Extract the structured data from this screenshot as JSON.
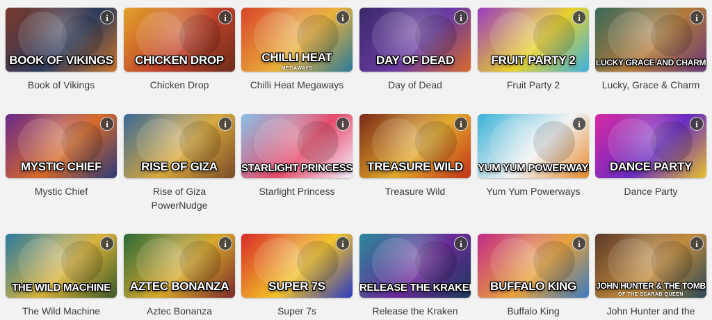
{
  "games": [
    {
      "title": "Book of Vikings",
      "art_title": "BOOK OF VIKINGS",
      "bg": "#7a3a2a,#2e3b5c,#c8742c"
    },
    {
      "title": "Chicken Drop",
      "art_title": "CHICKEN DROP",
      "bg": "#e2a32a,#c2412a,#6b2d1b"
    },
    {
      "title": "Chilli Heat Megaways",
      "art_title": "CHILLI HEAT",
      "art_sub": "MEGAWAYS",
      "bg": "#d8452a,#e9b13a,#2a7a9a"
    },
    {
      "title": "Day of Dead",
      "art_title": "DAY OF DEAD",
      "bg": "#3a2a6a,#6a3aa2,#d86a2a"
    },
    {
      "title": "Fruit Party 2",
      "art_title": "FRUIT PARTY 2",
      "bg": "#9a3ac2,#e8d12a,#3ab2e2"
    },
    {
      "title": "Lucky, Grace & Charm",
      "art_title": "LUCKY GRACE AND CHARM",
      "bg": "#3a6a5a,#b27a3a,#6a3a7a"
    },
    {
      "title": "Mystic Chief",
      "art_title": "MYSTIC CHIEF",
      "bg": "#6a2a8a,#d86a2a,#2a3a7a"
    },
    {
      "title": "Rise of Giza\nPowerNudge",
      "art_title": "RISE OF GIZA",
      "bg": "#3a6a9a,#d8a83a,#7a4a2a"
    },
    {
      "title": "Starlight Princess",
      "art_title": "STARLIGHT PRINCESS",
      "bg": "#8ac2e8,#e84a6a,#f2f2ff"
    },
    {
      "title": "Treasure Wild",
      "art_title": "TREASURE WILD",
      "bg": "#7a2a1a,#e2a82a,#c2321a"
    },
    {
      "title": "Yum Yum Powerways",
      "art_title": "YUM YUM POWERWAYS",
      "bg": "#3ab2d8,#f2f2f2,#e88a2a"
    },
    {
      "title": "Dance Party",
      "art_title": "DANCE PARTY",
      "bg": "#d82aa2,#6a2ac2,#e8c22a"
    },
    {
      "title": "The Wild Machine",
      "art_title": "THE WILD MACHINE",
      "bg": "#2a7aa2,#d8b23a,#3a5a2a"
    },
    {
      "title": "Aztec Bonanza",
      "art_title": "AZTEC BONANZA",
      "bg": "#2a6a3a,#d8a82a,#7a2a2a"
    },
    {
      "title": "Super 7s",
      "art_title": "SUPER 7S",
      "bg": "#d82a2a,#f2c22a,#2a3ac2"
    },
    {
      "title": "Release the Kraken",
      "art_title": "RELEASE THE KRAKEN",
      "bg": "#2a8a9a,#6a2a9a,#1a3a5a"
    },
    {
      "title": "Buffalo King",
      "art_title": "BUFFALO KING",
      "bg": "#c22a8a,#e8a23a,#3a7ac2"
    },
    {
      "title": "John Hunter and the",
      "art_title": "JOHN HUNTER & THE TOMB",
      "art_sub": "OF THE SCARAB QUEEN",
      "bg": "#5a3a2a,#c28a3a,#2a4a5a"
    }
  ],
  "info_glyph": "i",
  "icons": {
    "info": "info-icon"
  }
}
